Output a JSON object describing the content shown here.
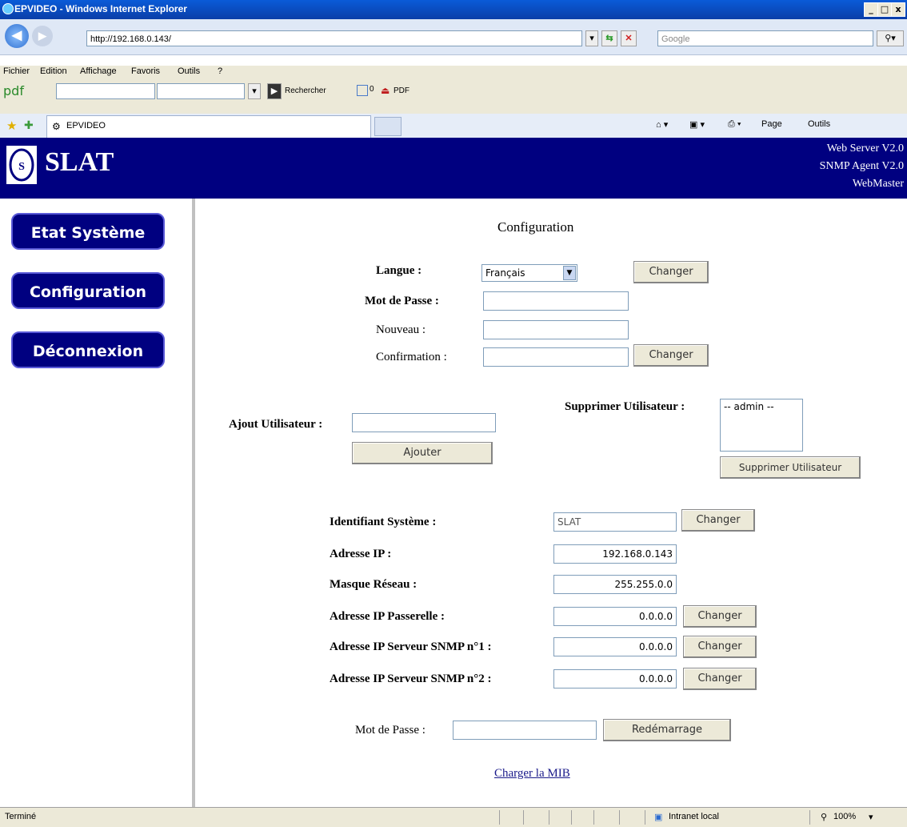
{
  "window": {
    "title": "EPVIDEO - Windows Internet Explorer",
    "controls": [
      "_",
      "□",
      "x"
    ]
  },
  "browser": {
    "url": "http://192.168.0.143/",
    "search_placeholder": "Google",
    "menu": [
      "Fichier",
      "Edition",
      "Affichage",
      "Favoris",
      "Outils",
      "?"
    ],
    "toolbar_pdf": "pdf",
    "rechercher": "Rechercher",
    "counter": "0",
    "pdf_btn": "PDF",
    "tab_title": "EPVIDEO",
    "right_tools": [
      "Page",
      "Outils"
    ]
  },
  "header": {
    "brand": "SLAT",
    "lines": [
      "Web Server V2.0",
      "SNMP Agent V2.0",
      "WebMaster"
    ]
  },
  "nav": [
    "Etat Système",
    "Configuration",
    "Déconnexion"
  ],
  "config": {
    "title": "Configuration",
    "langue_label": "Langue :",
    "langue_value": "Français",
    "changer": "Changer",
    "mdp_label": "Mot de Passe :",
    "nouveau_label": "Nouveau :",
    "confirmation_label": "Confirmation :",
    "ajout_label": "Ajout Utilisateur :",
    "ajouter": "Ajouter",
    "suppr_label": "Supprimer Utilisateur :",
    "suppr_list": [
      "-- admin --"
    ],
    "suppr_btn": "Supprimer Utilisateur",
    "ident_label": "Identifiant Système :",
    "ident_value": "SLAT",
    "ip_label": "Adresse IP :",
    "ip_value": "192.168.0.143",
    "mask_label": "Masque Réseau :",
    "mask_value": "255.255.0.0",
    "gw_label": "Adresse IP Passerelle :",
    "gw_value": "0.0.0.0",
    "snmp1_label": "Adresse IP Serveur SNMP n°1 :",
    "snmp1_value": "0.0.0.0",
    "snmp2_label": "Adresse IP Serveur SNMP n°2 :",
    "snmp2_value": "0.0.0.0",
    "restart_pw_label": "Mot de Passe :",
    "restart_btn": "Redémarrage",
    "mib_link": "Charger la MIB"
  },
  "status": {
    "left": "Terminé",
    "zone": "Intranet local",
    "zoom": "100%"
  }
}
